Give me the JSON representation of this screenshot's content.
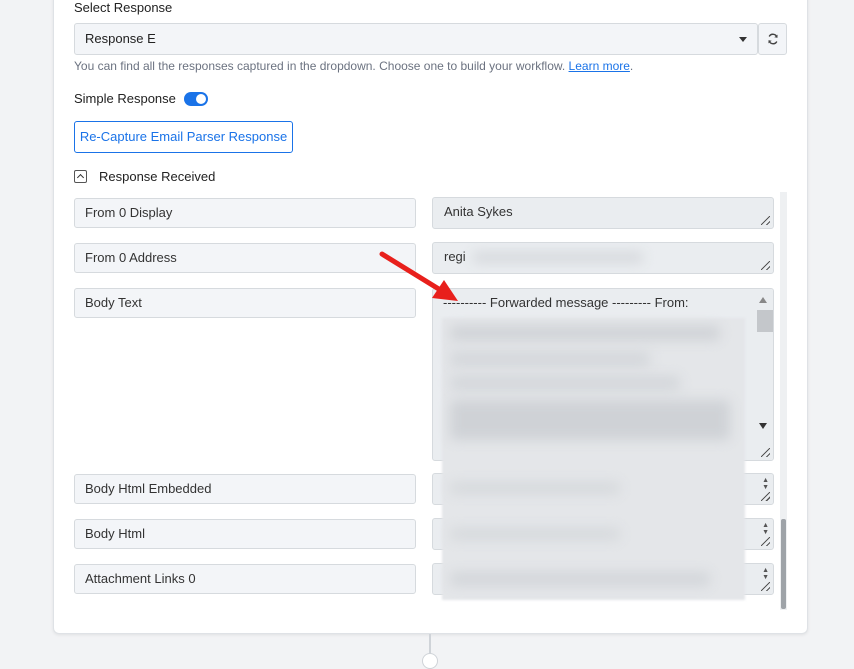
{
  "header": {
    "select_label": "Select Response",
    "selected_response": "Response E",
    "hint_text": "You can find all the responses captured in the dropdown. Choose one to build your workflow.",
    "hint_link": "Learn more",
    "hint_suffix": ".",
    "simple_response_label": "Simple Response",
    "simple_response_on": true,
    "recapture_button": "Re-Capture Email Parser Response",
    "response_received_label": "Response Received"
  },
  "fields": [
    {
      "key": "From 0 Display",
      "value": "Anita Sykes"
    },
    {
      "key": "From 0 Address",
      "value": "regi"
    },
    {
      "key": "Body Text",
      "value": "---------- Forwarded message --------- From:"
    },
    {
      "key": "Body Html Embedded",
      "value": ""
    },
    {
      "key": "Body Html",
      "value": ""
    },
    {
      "key": "Attachment Links 0",
      "value": ""
    }
  ],
  "colors": {
    "accent": "#1a73e8",
    "annotation_arrow": "#e8201c"
  }
}
